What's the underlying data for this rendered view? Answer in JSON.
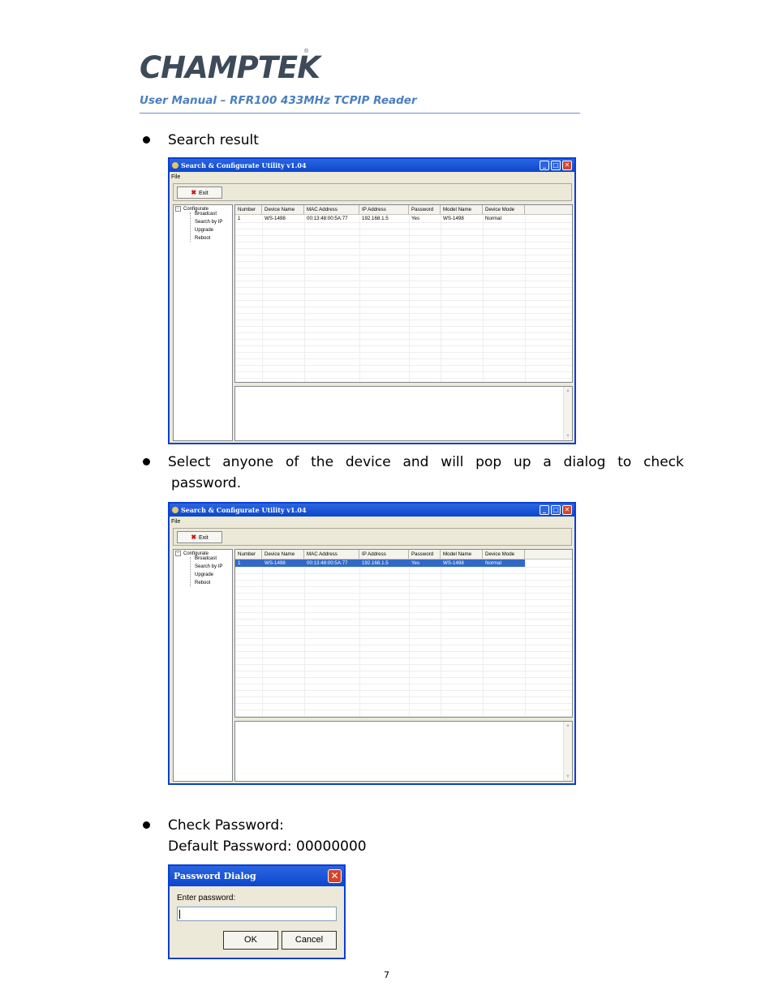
{
  "header": {
    "logo_text": "CHAMPTEK",
    "logo_registered": "®",
    "subtitle": "User Manual – RFR100 433MHz TCPIP Reader"
  },
  "sections": {
    "search_result": "Search result",
    "select_device_line1": "Select  anyone  of  the  device  and  will  pop  up  a  dialog  to  check",
    "select_device_line2": "password.",
    "check_password": "Check Password:",
    "default_password": "Default Password: 00000000"
  },
  "utility_window": {
    "title": "Search  & Configurate Utility v1.04",
    "menu_file": "File",
    "exit_label": "Exit",
    "minimize": "_",
    "maximize": "□",
    "close": "✕",
    "tree": {
      "expander": "−",
      "root": "Configurate",
      "children": [
        "Broadcast",
        "Search by IP",
        "Upgrade",
        "Reboot"
      ]
    },
    "columns": [
      "Number",
      "Device Name",
      "MAC Address",
      "IP Address",
      "Password",
      "Model Name",
      "Device Mode"
    ],
    "rows": [
      [
        "1",
        "WS-1498",
        "00:13:48:00:5A:77",
        "192.168.1.5",
        "Yes",
        "WS-1498",
        "Normal"
      ]
    ],
    "scroll_up": "▲",
    "scroll_down": "▼"
  },
  "password_dialog": {
    "title": "Password Dialog",
    "close": "✕",
    "label": "Enter password:",
    "value": "",
    "ok_label": "OK",
    "cancel_label": "Cancel"
  },
  "page_number": "7"
}
